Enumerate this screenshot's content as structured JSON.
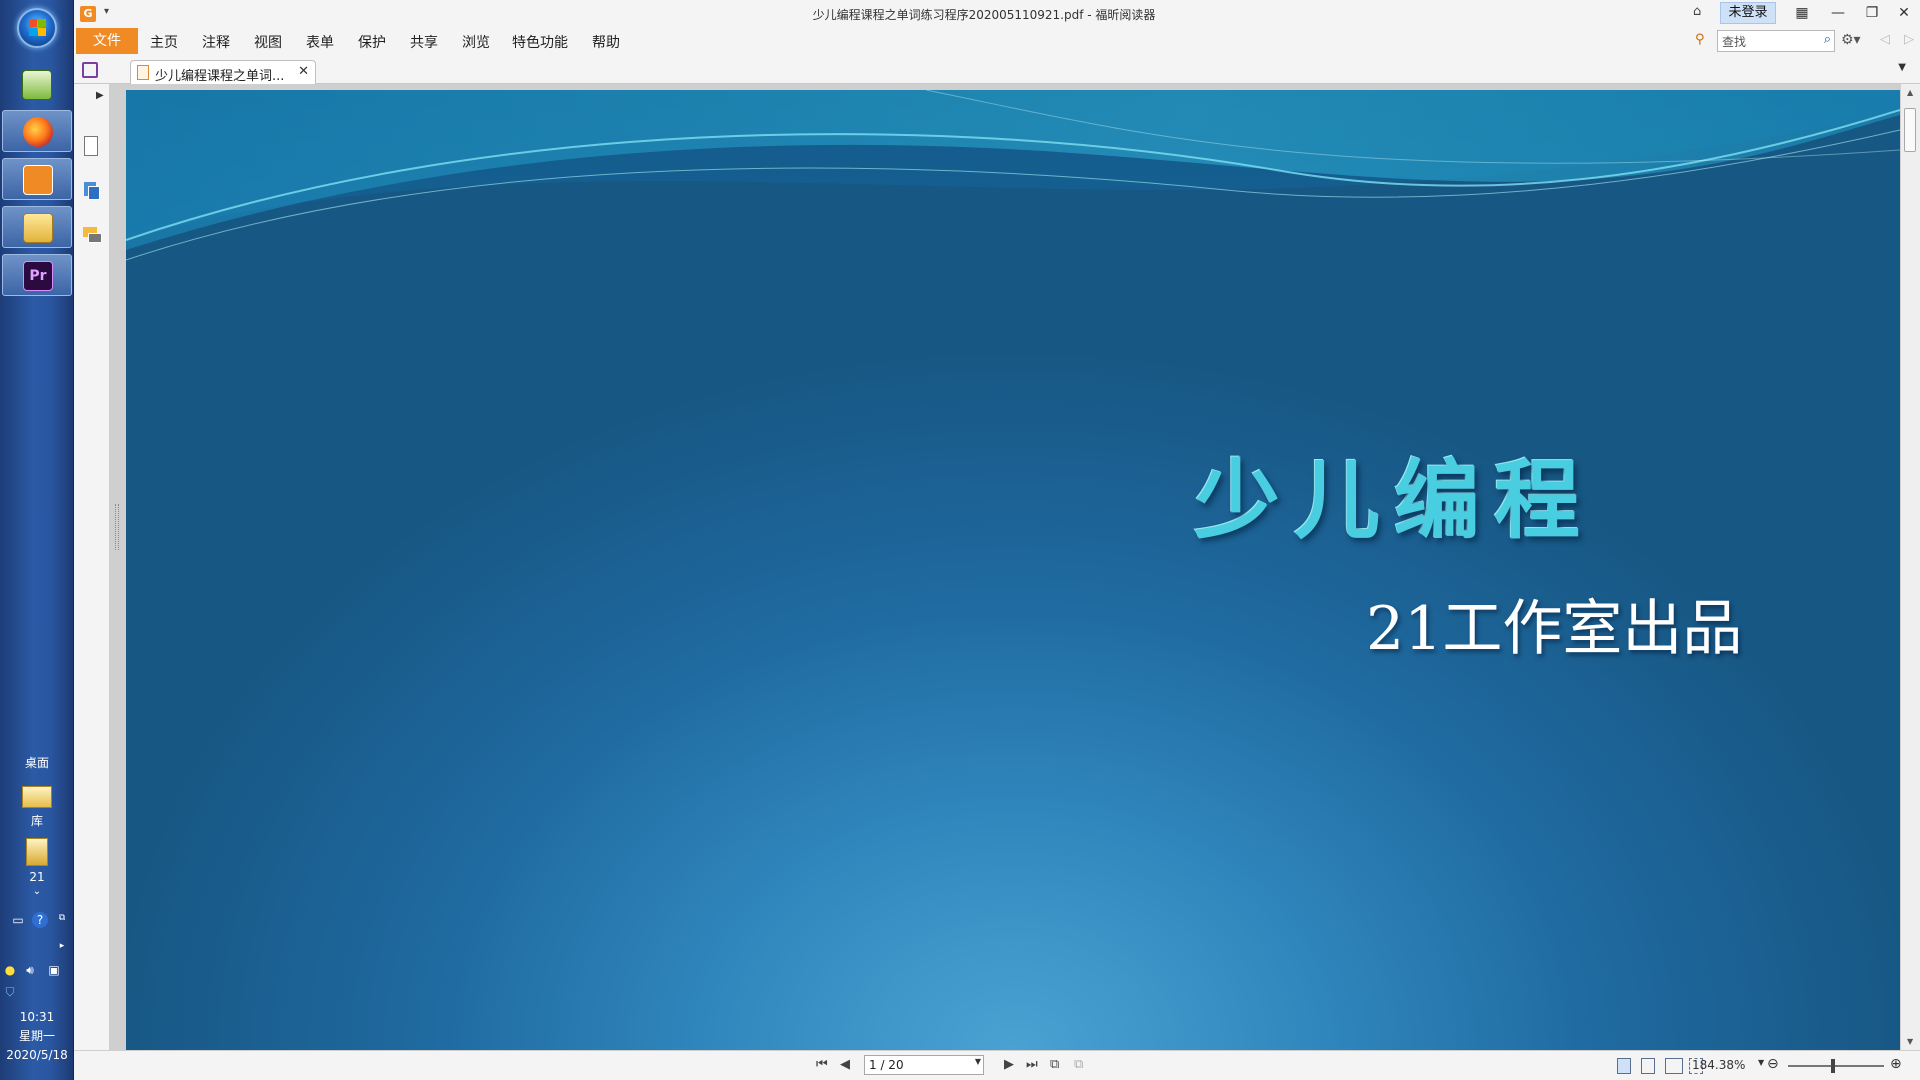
{
  "taskbar": {
    "apps": [
      {
        "name": "spreadsheet-app",
        "active": false
      },
      {
        "name": "firefox",
        "active": true
      },
      {
        "name": "foxit-reader",
        "active": true
      },
      {
        "name": "file-explorer",
        "active": true
      },
      {
        "name": "premiere-pro",
        "active": true,
        "label": "Pr"
      }
    ],
    "desktop_label": "桌面",
    "library_label": "库",
    "folder_label": "21",
    "clock": {
      "time": "10:31",
      "weekday": "星期一",
      "date": "2020/5/18"
    }
  },
  "window": {
    "title": "少儿编程课程之单词练习程序202005110921.pdf - 福昕阅读器",
    "login_label": "未登录"
  },
  "menu": {
    "file": "文件",
    "items": [
      "主页",
      "注释",
      "视图",
      "表单",
      "保护",
      "共享",
      "浏览",
      "特色功能",
      "帮助"
    ]
  },
  "search": {
    "placeholder": "查找"
  },
  "tab": {
    "label": "少儿编程课程之单词..."
  },
  "slide": {
    "title": "少儿编程",
    "subtitle": "21工作室出品"
  },
  "status": {
    "page_value": "1 / 20",
    "zoom": "184.38%",
    "zoom_fraction": 0.47
  },
  "colors": {
    "accent_orange": "#f08a24",
    "slide_title": "#49cde0",
    "slide_bg_dark": "#175784",
    "slide_bg_light": "#4aa2d3"
  }
}
